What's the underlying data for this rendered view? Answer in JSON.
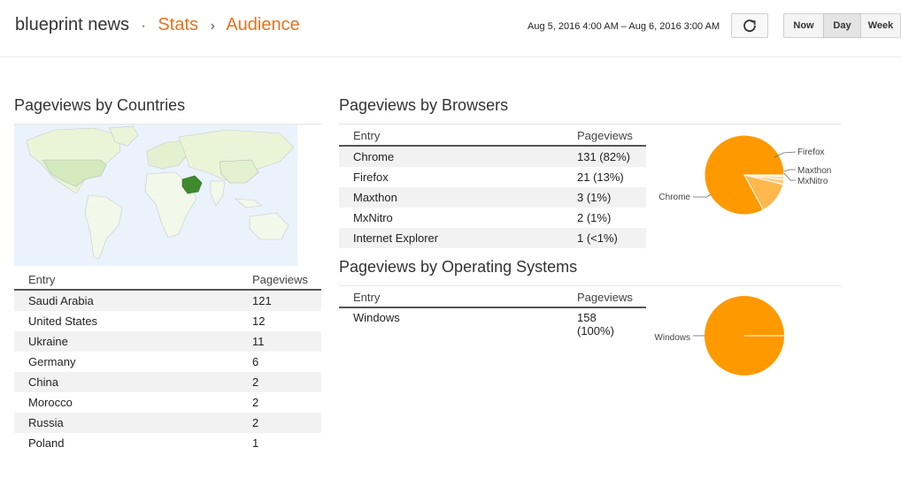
{
  "header": {
    "site_name": "blueprint news",
    "dot": "·",
    "crumb_stats": "Stats",
    "arrow": "›",
    "crumb_audience": "Audience",
    "date_range": "Aug 5, 2016 4:00 AM – Aug 6, 2016 3:00 AM",
    "buttons": {
      "now": "Now",
      "day": "Day",
      "week": "Week"
    },
    "active_range": "Day",
    "refresh_icon": "refresh-icon"
  },
  "countries": {
    "title": "Pageviews by Countries",
    "columns": {
      "entry": "Entry",
      "pageviews": "Pageviews"
    },
    "rows": [
      {
        "entry": "Saudi Arabia",
        "pageviews": "121"
      },
      {
        "entry": "United States",
        "pageviews": "12"
      },
      {
        "entry": "Ukraine",
        "pageviews": "11"
      },
      {
        "entry": "Germany",
        "pageviews": "6"
      },
      {
        "entry": "China",
        "pageviews": "2"
      },
      {
        "entry": "Morocco",
        "pageviews": "2"
      },
      {
        "entry": "Russia",
        "pageviews": "2"
      },
      {
        "entry": "Poland",
        "pageviews": "1"
      }
    ]
  },
  "browsers": {
    "title": "Pageviews by Browsers",
    "columns": {
      "entry": "Entry",
      "pageviews": "Pageviews"
    },
    "rows": [
      {
        "entry": "Chrome",
        "pageviews": "131 (82%)"
      },
      {
        "entry": "Firefox",
        "pageviews": "21 (13%)"
      },
      {
        "entry": "Maxthon",
        "pageviews": "3 (1%)"
      },
      {
        "entry": "MxNitro",
        "pageviews": "2 (1%)"
      },
      {
        "entry": "Internet Explorer",
        "pageviews": "1 (<1%)"
      }
    ],
    "pie": {
      "slices": [
        {
          "label": "Chrome",
          "value": 131,
          "color": "#ff9900"
        },
        {
          "label": "Firefox",
          "value": 21,
          "color": "#ffb84d"
        },
        {
          "label": "Maxthon",
          "value": 3,
          "color": "#ffcc80"
        },
        {
          "label": "MxNitro",
          "value": 2,
          "color": "#ffd9a3"
        },
        {
          "label": "",
          "value": 1,
          "color": "#ffe3bf"
        }
      ]
    }
  },
  "os": {
    "title": "Pageviews by Operating Systems",
    "columns": {
      "entry": "Entry",
      "pageviews": "Pageviews"
    },
    "rows": [
      {
        "entry": "Windows",
        "pageviews_line1": "158",
        "pageviews_line2": "(100%)"
      }
    ],
    "pie": {
      "slices": [
        {
          "label": "Windows",
          "value": 158,
          "color": "#ff9900"
        }
      ]
    }
  },
  "colors": {
    "accent": "#e8711c",
    "pie_main": "#ff9900",
    "map_highlight": "#3f8a2e",
    "map_land": "#eaf5d8"
  }
}
